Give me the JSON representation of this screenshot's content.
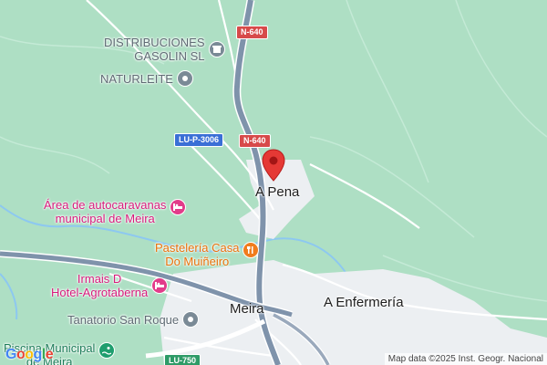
{
  "map": {
    "background_color": "#aedfc4",
    "road_color": "#7f93ab",
    "town_color": "#eceff2",
    "water_color": "#8dc8f0",
    "marker_color": "#e53935"
  },
  "roads": {
    "n640_top": "N-640",
    "n640_mid": "N-640",
    "lu_p_3006": "LU-P-3006",
    "lu_750": "LU-750"
  },
  "places": {
    "a_pena": "A Pena",
    "meira": "Meira",
    "a_enfermeria": "A Enfermería"
  },
  "pois": {
    "distribuciones": {
      "name_line1": "DISTRIBUCIONES",
      "name_line2": "GASOLIN SL",
      "icon": "store-icon",
      "color": "#5f6b74"
    },
    "naturleite": {
      "name": "NATURLEITE",
      "icon": "store-icon",
      "color": "#5f6b74"
    },
    "autocaravanas": {
      "name_line1": "Área de autocaravanas",
      "name_line2": "municipal de Meira",
      "icon": "bed-icon",
      "color": "#d81b7c"
    },
    "pasteleria": {
      "name_line1": "Pastelería Casa",
      "name_line2": "Do Muiñeiro",
      "icon": "restaurant-icon",
      "color": "#e8710a"
    },
    "hotel": {
      "name_line1": "Irmais D",
      "name_line2": "Hotel-Agrotaberna",
      "icon": "bed-icon",
      "color": "#d81b7c"
    },
    "tanatorio": {
      "name": "Tanatorio San Roque",
      "icon": "store-icon",
      "color": "#5f6b74"
    },
    "piscina": {
      "name_line1": "Piscina Municipal",
      "name_line2": "de Meira",
      "icon": "swimming-icon",
      "color": "#1e7d5a"
    }
  },
  "attribution": "Map data ©2025 Inst. Geogr. Nacional",
  "logo": {
    "letters": [
      "G",
      "o",
      "o",
      "g",
      "l",
      "e"
    ]
  }
}
